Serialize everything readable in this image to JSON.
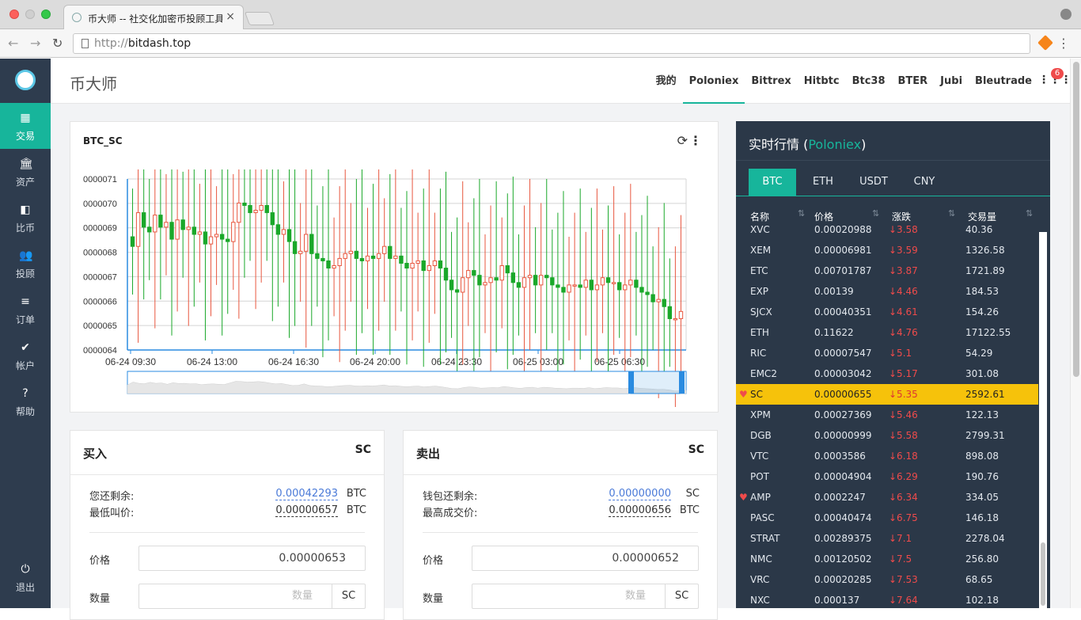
{
  "browser": {
    "tab_title": "币大师 -- 社交化加密币投顾工具",
    "tab_close": "×",
    "url_proto": "http://",
    "url_host": "bitdash.top",
    "nav_back": "←",
    "nav_fwd": "→",
    "nav_reload": "↻",
    "menu": "⋮"
  },
  "sidebar": {
    "items": [
      {
        "label": "交易",
        "icon": "▦"
      },
      {
        "label": "资产",
        "icon": "🏛"
      },
      {
        "label": "比币",
        "icon": "◧"
      },
      {
        "label": "投顾",
        "icon": "👥"
      },
      {
        "label": "订单",
        "icon": "≡"
      },
      {
        "label": "帐户",
        "icon": "✔"
      },
      {
        "label": "帮助",
        "icon": "?"
      }
    ],
    "logout": {
      "label": "退出",
      "icon": "⏻"
    }
  },
  "header": {
    "brand": "币大师",
    "exchanges": [
      "我的",
      "Poloniex",
      "Bittrex",
      "Hitbtc",
      "Btc38",
      "BTER",
      "Jubi",
      "Bleutrade"
    ],
    "active_exchange": "Poloniex",
    "grid_icon": "⋮⋮⋮",
    "badge": "6"
  },
  "chart_card": {
    "pair": "BTC_SC",
    "refresh_icon": "⟳",
    "more_icon": "⋮"
  },
  "chart_data": {
    "type": "candlestick",
    "title": "BTC_SC",
    "y_ticks": [
      "0000064",
      "0000065",
      "0000066",
      "0000067",
      "0000068",
      "0000069",
      "0000070",
      "0000071"
    ],
    "ylim": [
      6.4e-06,
      7.11e-06
    ],
    "x_ticks": [
      "06-24 09:30",
      "06-24 13:00",
      "06-24 16:30",
      "06-24 20:00",
      "06-24 23:30",
      "06-25 03:00",
      "06-25 06:30"
    ],
    "series": [
      {
        "closes": [
          6.83e-06,
          6.97e-06,
          6.91e-06,
          6.89e-06,
          6.96e-06,
          6.91e-06,
          6.93e-06,
          6.86e-06,
          6.94e-06,
          6.9e-06,
          6.91e-06,
          6.88e-06,
          6.89e-06,
          6.84e-06,
          6.87e-06,
          6.88e-06,
          6.86e-06,
          6.85e-06,
          6.93e-06,
          7.01e-06,
          7e-06,
          6.97e-06,
          6.98e-06,
          7e-06,
          6.97e-06,
          6.92e-06,
          6.88e-06,
          6.9e-06,
          6.85e-06,
          6.8e-06,
          6.81e-06,
          6.88e-06,
          6.8e-06,
          6.78e-06,
          6.77e-06,
          6.74e-06,
          6.75e-06,
          6.78e-06,
          6.8e-06,
          6.81e-06,
          6.78e-06,
          6.77e-06,
          6.79e-06,
          6.78e-06,
          6.8e-06,
          6.83e-06,
          6.78e-06,
          6.79e-06,
          6.76e-06,
          6.74e-06,
          6.76e-06,
          6.77e-06,
          6.73e-06,
          6.75e-06,
          6.77e-06,
          6.74e-06,
          6.69e-06,
          6.65e-06,
          6.64e-06,
          6.7e-06,
          6.73e-06,
          6.71e-06,
          6.67e-06,
          6.68e-06,
          6.7e-06,
          6.69e-06,
          6.75e-06,
          6.72e-06,
          6.68e-06,
          6.66e-06,
          6.7e-06,
          6.71e-06,
          6.67e-06,
          6.71e-06,
          6.7e-06,
          6.67e-06,
          6.66e-06,
          6.64e-06,
          6.67e-06,
          6.67e-06,
          6.66e-06,
          6.69e-06,
          6.65e-06,
          6.67e-06,
          6.7e-06,
          6.68e-06,
          6.68e-06,
          6.65e-06,
          6.67e-06,
          6.69e-06,
          6.66e-06,
          6.64e-06,
          6.63e-06,
          6.6e-06,
          6.61e-06,
          6.58e-06,
          6.53e-06,
          6.53e-06,
          6.56e-06
        ]
      }
    ],
    "opens": [
      6.87e-06,
      6.83e-06,
      6.97e-06,
      6.91e-06,
      6.89e-06,
      6.96e-06,
      6.91e-06,
      6.93e-06,
      6.86e-06,
      6.94e-06,
      6.9e-06,
      6.91e-06,
      6.88e-06,
      6.89e-06,
      6.84e-06,
      6.87e-06,
      6.88e-06,
      6.86e-06,
      6.85e-06,
      6.93e-06,
      7.01e-06,
      7e-06,
      6.97e-06,
      6.98e-06,
      7e-06,
      6.97e-06,
      6.92e-06,
      6.88e-06,
      6.9e-06,
      6.85e-06,
      6.8e-06,
      6.81e-06,
      6.88e-06,
      6.8e-06,
      6.78e-06,
      6.77e-06,
      6.74e-06,
      6.75e-06,
      6.78e-06,
      6.8e-06,
      6.81e-06,
      6.78e-06,
      6.77e-06,
      6.79e-06,
      6.78e-06,
      6.8e-06,
      6.83e-06,
      6.78e-06,
      6.79e-06,
      6.76e-06,
      6.74e-06,
      6.76e-06,
      6.77e-06,
      6.73e-06,
      6.75e-06,
      6.77e-06,
      6.74e-06,
      6.69e-06,
      6.65e-06,
      6.64e-06,
      6.7e-06,
      6.73e-06,
      6.71e-06,
      6.67e-06,
      6.68e-06,
      6.7e-06,
      6.69e-06,
      6.75e-06,
      6.72e-06,
      6.68e-06,
      6.66e-06,
      6.7e-06,
      6.71e-06,
      6.67e-06,
      6.71e-06,
      6.7e-06,
      6.67e-06,
      6.66e-06,
      6.64e-06,
      6.67e-06,
      6.67e-06,
      6.66e-06,
      6.69e-06,
      6.65e-06,
      6.67e-06,
      6.7e-06,
      6.68e-06,
      6.68e-06,
      6.65e-06,
      6.67e-06,
      6.69e-06,
      6.66e-06,
      6.64e-06,
      6.63e-06,
      6.6e-06,
      6.61e-06,
      6.58e-06,
      6.53e-06,
      6.53e-06
    ],
    "grid": true
  },
  "buy": {
    "title": "买入",
    "coin": "SC",
    "rows": [
      {
        "k": "您还剩余:",
        "v": "0.00042293",
        "u": "BTC"
      },
      {
        "k": "最低叫价:",
        "v": "0.00000657",
        "u": "BTC"
      }
    ],
    "price_label": "价格",
    "price_value": "0.00000653",
    "qty_label": "数量",
    "qty_placeholder": "数量",
    "qty_unit": "SC"
  },
  "sell": {
    "title": "卖出",
    "coin": "SC",
    "rows": [
      {
        "k": "钱包还剩余:",
        "v": "0.00000000",
        "u": "SC"
      },
      {
        "k": "最高成交价:",
        "v": "0.00000656",
        "u": "BTC"
      }
    ],
    "price_label": "价格",
    "price_value": "0.00000652",
    "qty_label": "数量",
    "qty_placeholder": "数量",
    "qty_unit": "SC"
  },
  "market": {
    "title_prefix": "实时行情 (",
    "title_exchange": "Poloniex",
    "title_suffix": ")",
    "tabs": [
      "BTC",
      "ETH",
      "USDT",
      "CNY"
    ],
    "active_tab": "BTC",
    "columns": [
      "名称",
      "价格",
      "涨跌",
      "交易量"
    ],
    "sort_icon": "⇅",
    "rows": [
      {
        "name": "XVC",
        "price": "0.00020988",
        "change": "↓3.58",
        "volume": "40.36",
        "fav": false,
        "hl": false
      },
      {
        "name": "XEM",
        "price": "0.00006981",
        "change": "↓3.59",
        "volume": "1326.58",
        "fav": false,
        "hl": false
      },
      {
        "name": "ETC",
        "price": "0.00701787",
        "change": "↓3.87",
        "volume": "1721.89",
        "fav": false,
        "hl": false
      },
      {
        "name": "EXP",
        "price": "0.00139",
        "change": "↓4.46",
        "volume": "184.53",
        "fav": false,
        "hl": false
      },
      {
        "name": "SJCX",
        "price": "0.00040351",
        "change": "↓4.61",
        "volume": "154.26",
        "fav": false,
        "hl": false
      },
      {
        "name": "ETH",
        "price": "0.11622",
        "change": "↓4.76",
        "volume": "17122.55",
        "fav": false,
        "hl": false
      },
      {
        "name": "RIC",
        "price": "0.00007547",
        "change": "↓5.1",
        "volume": "54.29",
        "fav": false,
        "hl": false
      },
      {
        "name": "EMC2",
        "price": "0.00003042",
        "change": "↓5.17",
        "volume": "301.08",
        "fav": false,
        "hl": false
      },
      {
        "name": "SC",
        "price": "0.00000655",
        "change": "↓5.35",
        "volume": "2592.61",
        "fav": true,
        "hl": true
      },
      {
        "name": "XPM",
        "price": "0.00027369",
        "change": "↓5.46",
        "volume": "122.13",
        "fav": false,
        "hl": false
      },
      {
        "name": "DGB",
        "price": "0.00000999",
        "change": "↓5.58",
        "volume": "2799.31",
        "fav": false,
        "hl": false
      },
      {
        "name": "VTC",
        "price": "0.0003586",
        "change": "↓6.18",
        "volume": "898.08",
        "fav": false,
        "hl": false
      },
      {
        "name": "POT",
        "price": "0.00004904",
        "change": "↓6.29",
        "volume": "190.76",
        "fav": false,
        "hl": false
      },
      {
        "name": "AMP",
        "price": "0.0002247",
        "change": "↓6.34",
        "volume": "334.05",
        "fav": true,
        "hl": false
      },
      {
        "name": "PASC",
        "price": "0.00040474",
        "change": "↓6.75",
        "volume": "146.18",
        "fav": false,
        "hl": false
      },
      {
        "name": "STRAT",
        "price": "0.00289375",
        "change": "↓7.1",
        "volume": "2278.04",
        "fav": false,
        "hl": false
      },
      {
        "name": "NMC",
        "price": "0.00120502",
        "change": "↓7.5",
        "volume": "256.80",
        "fav": false,
        "hl": false
      },
      {
        "name": "VRC",
        "price": "0.00020285",
        "change": "↓7.53",
        "volume": "68.65",
        "fav": false,
        "hl": false
      },
      {
        "name": "NXC",
        "price": "0.000137",
        "change": "↓7.64",
        "volume": "102.18",
        "fav": false,
        "hl": false
      }
    ]
  },
  "colors": {
    "accent": "#17b59b",
    "sidebar": "#2e3c4e",
    "market_bg": "#2b3848",
    "up": "#e8573f",
    "down": "#1aa82a",
    "highlight": "#f6c20b"
  }
}
